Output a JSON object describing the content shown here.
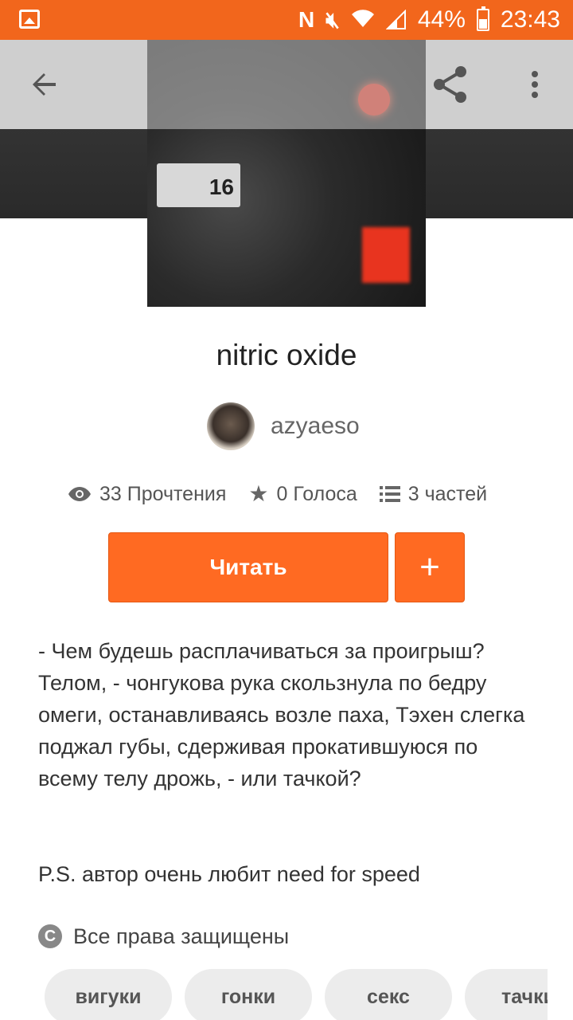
{
  "status_bar": {
    "battery": "44%",
    "time": "23:43",
    "icons": [
      "image-icon",
      "nfc-icon",
      "mute-icon",
      "wifi-icon",
      "signal-icon",
      "battery-icon"
    ]
  },
  "toolbar": {
    "back_icon": "arrow-back-icon",
    "share_icon": "share-icon",
    "menu_icon": "more-vert-icon"
  },
  "cover": {
    "plate_text": "16"
  },
  "story": {
    "title": "nitric oxide",
    "author": "azyaeso",
    "reads": "33 Прочтения",
    "votes": "0 Голоса",
    "parts": "3 частей",
    "read_button": "Читать",
    "add_button": "+",
    "description": "- Чем будешь расплачиваться за проигрыш? Телом, - чонгукова рука скользнула по бедру омеги, останавливаясь возле паха, Тэхен слегка поджал губы, сдерживая прокатившуюся по всему телу дрожь, - или тачкой?",
    "ps": "P.S. автор очень любит need for speed",
    "copyright": "Все права защищены"
  },
  "tags": [
    "вигуки",
    "гонки",
    "секс",
    "тачки"
  ],
  "colors": {
    "accent": "#f2661c",
    "button": "#ff6a22"
  }
}
